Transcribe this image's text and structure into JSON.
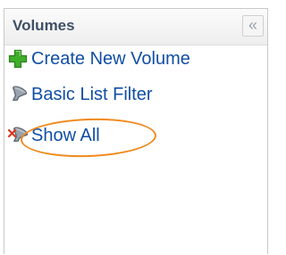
{
  "panel": {
    "title": "Volumes",
    "collapse_glyph": "«"
  },
  "actions": [
    {
      "label": "Create New Volume",
      "icon": "green-plus-icon"
    },
    {
      "label": "Basic List Filter",
      "icon": "filter-icon"
    },
    {
      "label": "Show All",
      "icon": "filter-clear-icon"
    }
  ],
  "colors": {
    "link": "#114ea5",
    "title": "#3f4f66",
    "highlight": "#f08a1c",
    "plus": "#3fae2a"
  }
}
